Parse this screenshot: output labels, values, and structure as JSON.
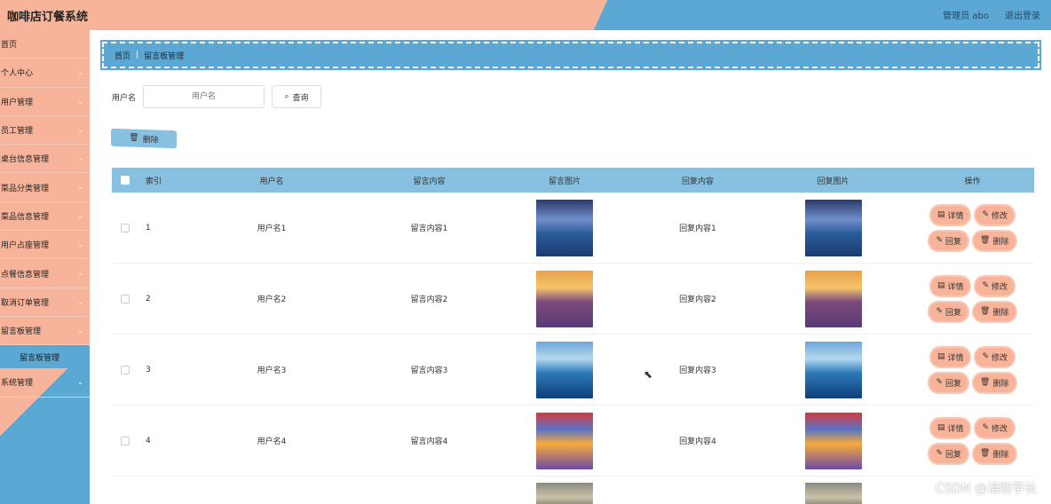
{
  "app": {
    "title": "咖啡店订餐系统"
  },
  "header": {
    "user": "管理员 abo",
    "logout": "退出登录"
  },
  "sidebar": {
    "items": [
      {
        "label": "首页",
        "chevron": false
      },
      {
        "label": "个人中心",
        "chevron": true
      },
      {
        "label": "用户管理",
        "chevron": true
      },
      {
        "label": "员工管理",
        "chevron": true
      },
      {
        "label": "桌台信息管理",
        "chevron": true
      },
      {
        "label": "菜品分类管理",
        "chevron": true
      },
      {
        "label": "菜品信息管理",
        "chevron": true
      },
      {
        "label": "用户占座管理",
        "chevron": true
      },
      {
        "label": "点餐信息管理",
        "chevron": true
      },
      {
        "label": "取消订单管理",
        "chevron": true
      },
      {
        "label": "留言板管理",
        "chevron": true
      }
    ],
    "active_sub": "留言板管理",
    "last_item": "系统管理"
  },
  "breadcrumb": {
    "home": "首页",
    "current": "留言板管理"
  },
  "search": {
    "label": "用户名",
    "placeholder": "用户名",
    "button": "查询"
  },
  "toolbar": {
    "delete": "删除"
  },
  "table": {
    "columns": [
      "索引",
      "用户名",
      "留言内容",
      "留言图片",
      "回复内容",
      "回复图片",
      "操作"
    ],
    "rows": [
      {
        "index": "1",
        "user": "用户名1",
        "message": "留言内容1",
        "reply": "回复内容1",
        "img": "t1"
      },
      {
        "index": "2",
        "user": "用户名2",
        "message": "留言内容2",
        "reply": "回复内容2",
        "img": "t2"
      },
      {
        "index": "3",
        "user": "用户名3",
        "message": "留言内容3",
        "reply": "回复内容3",
        "img": "t3"
      },
      {
        "index": "4",
        "user": "用户名4",
        "message": "留言内容4",
        "reply": "回复内容4",
        "img": "t4"
      }
    ],
    "ops": {
      "detail": "详情",
      "edit": "修改",
      "reply": "回复",
      "delete": "删除"
    }
  },
  "watermark": "CSDN @涪陵学长",
  "icons": {
    "chevron": "chevron-down-icon",
    "search": "search-icon",
    "trash": "trash-icon",
    "doc": "document-icon",
    "pencil": "pencil-icon"
  }
}
